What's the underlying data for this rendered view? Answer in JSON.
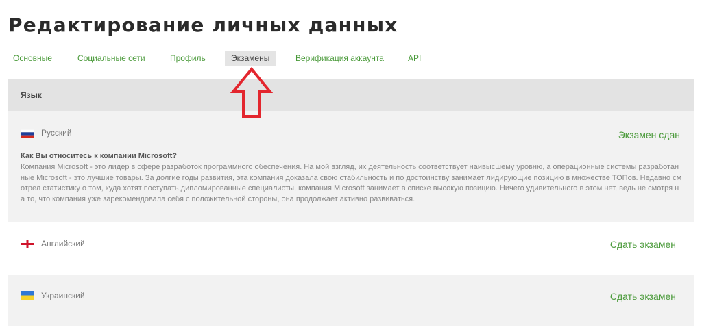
{
  "page": {
    "title": "Редактирование личных данных"
  },
  "tabs": [
    {
      "label": "Основные",
      "active": false
    },
    {
      "label": "Социальные сети",
      "active": false
    },
    {
      "label": "Профиль",
      "active": false
    },
    {
      "label": "Экзамены",
      "active": true
    },
    {
      "label": "Верификация аккаунта",
      "active": false
    },
    {
      "label": "API",
      "active": false
    }
  ],
  "languages_header": "Язык",
  "languages": [
    {
      "name": "Русский",
      "flag": "russia-flag-icon",
      "status": "Экзамен сдан",
      "question": "Как Вы относитесь к компании Microsoft?",
      "answer": "Компания Microsoft - это лидер в сфере разработок программного обеспечения. На мой взгляд, их деятельность соответствует наивысшему уровню, а операционные системы разработанные Microsoft - это лучшие товары. За долгие годы развития, эта компания доказала свою стабильность и по достоинству занимает лидирующие позицию в множестве ТОПов. Недавно смотрел статистику о том, куда хотят поступать дипломированные специалисты, компания Microsoft занимает в списке высокую позицию. Ничего удивительного в этом нет, ведь не смотря на то, что компания уже зарекомендовала себя с положительной стороны, она продолжает активно развиваться."
    },
    {
      "name": "Английский",
      "flag": "england-flag-icon",
      "status": "Сдать экзамен"
    },
    {
      "name": "Украинский",
      "flag": "ukraine-flag-icon",
      "status": "Сдать экзамен"
    }
  ],
  "annotation": {
    "icon": "red-arrow-up-icon",
    "color": "#e3262e"
  },
  "colors": {
    "accent_green": "#4a9a3a",
    "panel_gray": "#e3e3e3",
    "card_gray": "#f2f2f2"
  }
}
